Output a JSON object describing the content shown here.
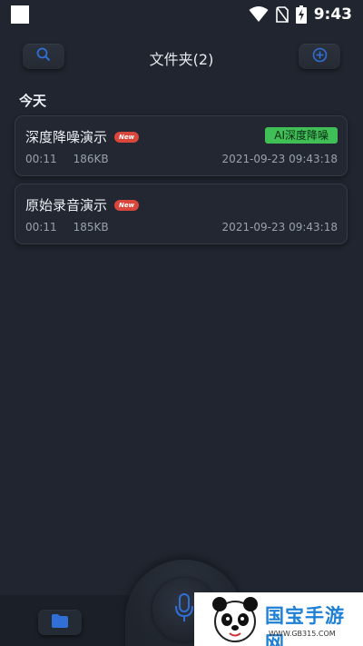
{
  "status_bar": {
    "time": "9:43",
    "icons": [
      "wifi-icon",
      "no-sim-icon",
      "battery-charging-icon"
    ]
  },
  "header": {
    "title": "文件夹(2)",
    "left_icon": "search-icon",
    "right_icon": "add-circle-icon"
  },
  "section": {
    "label": "今天"
  },
  "recordings": [
    {
      "name": "深度降噪演示",
      "badge": "New",
      "tag": "AI深度降噪",
      "duration": "00:11",
      "size": "186KB",
      "date": "2021-09-23 09:43:18"
    },
    {
      "name": "原始录音演示",
      "badge": "New",
      "duration": "00:11",
      "size": "185KB",
      "date": "2021-09-23 09:43:18"
    }
  ],
  "bottom": {
    "left_icon": "folder-icon",
    "center_icon": "microphone-icon"
  },
  "watermark": {
    "title": "国宝手游网",
    "url": "WWW.GB315.COM"
  },
  "colors": {
    "background": "#20252f",
    "ai_tag": "#3fbf55",
    "new_badge": "#d9463b",
    "accent_blue": "#2f6fd6"
  }
}
